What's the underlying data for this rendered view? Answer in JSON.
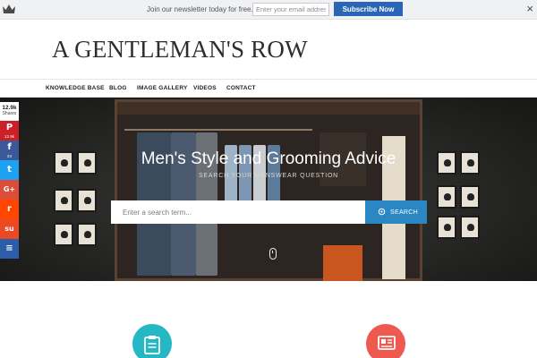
{
  "topbar": {
    "newsletter_text": "Join our newsletter today for free.",
    "email_placeholder": "Enter your email address",
    "subscribe_label": "Subscribe Now",
    "close_glyph": "×"
  },
  "header": {
    "logo": "A GENTLEMAN'S ROW"
  },
  "nav": {
    "items": [
      "KNOWLEDGE BASE",
      "BLOG",
      "IMAGE GALLERY",
      "VIDEOS",
      "CONTACT"
    ]
  },
  "hero": {
    "title": "Men's Style and Grooming Advice",
    "subtitle": "SEARCH YOUR MENSWEAR QUESTION",
    "search_placeholder": "Enter a search term...",
    "search_button": "SEARCH"
  },
  "share": {
    "total": "12.9k",
    "total_label": "Shares",
    "buttons": [
      {
        "network": "pinterest",
        "glyph": "P",
        "count": "12.9k",
        "color": "#cb2027"
      },
      {
        "network": "facebook",
        "glyph": "f",
        "count": "24",
        "color": "#3b5998"
      },
      {
        "network": "twitter",
        "glyph": "t",
        "count": "",
        "color": "#1da1f2"
      },
      {
        "network": "google-plus",
        "glyph": "G+",
        "count": "",
        "color": "#dd4b39"
      },
      {
        "network": "reddit",
        "glyph": "r",
        "count": "",
        "color": "#ff4500"
      },
      {
        "network": "stumbleupon",
        "glyph": "su",
        "count": "",
        "color": "#eb4924"
      },
      {
        "network": "buffer",
        "glyph": "≡",
        "count": "",
        "color": "#2d5da8"
      }
    ]
  },
  "features": [
    {
      "icon": "clipboard-icon",
      "color": "#26b7c5"
    },
    {
      "icon": "newspaper-icon",
      "color": "#ee5a4f"
    }
  ],
  "colors": {
    "accent": "#2a66b5",
    "search_button": "#2b87c4"
  }
}
